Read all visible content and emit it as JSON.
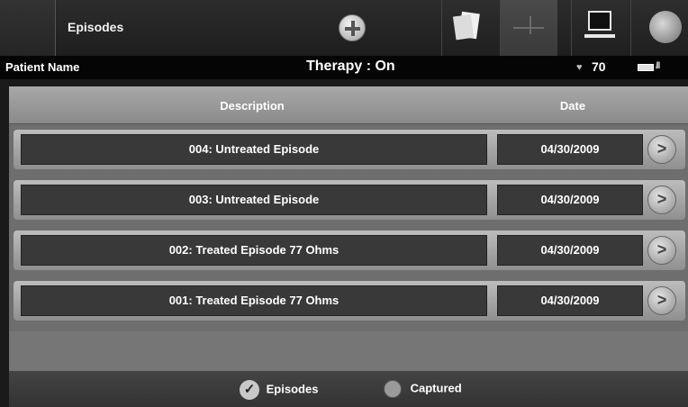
{
  "header": {
    "title": "Episodes",
    "add_icon": "plus-circle-icon",
    "tools": [
      {
        "name": "notes",
        "icon": "notes-icon"
      },
      {
        "name": "ecg",
        "icon": "ecg-icon"
      },
      {
        "name": "computer",
        "icon": "computer-icon"
      },
      {
        "name": "generator",
        "icon": "pulse-generator-icon"
      }
    ]
  },
  "status": {
    "patient_label": "Patient Name",
    "therapy": "Therapy : On",
    "heart_rate": "70",
    "heart_icon": "heart-icon",
    "battery_icon": "battery-icon",
    "signal_icon": "signal-icon"
  },
  "table": {
    "columns": [
      "Description",
      "Date"
    ],
    "rows": [
      {
        "description": "004: Untreated Episode",
        "date": "04/30/2009"
      },
      {
        "description": "003: Untreated Episode",
        "date": "04/30/2009"
      },
      {
        "description": "002: Treated Episode 77 Ohms",
        "date": "04/30/2009"
      },
      {
        "description": "001: Treated Episode 77 Ohms",
        "date": "04/30/2009"
      }
    ],
    "row_action_glyph": ">"
  },
  "filters": {
    "episodes_label": "Episodes",
    "episodes_checked": true,
    "captured_label": "Captured",
    "captured_checked": false
  }
}
